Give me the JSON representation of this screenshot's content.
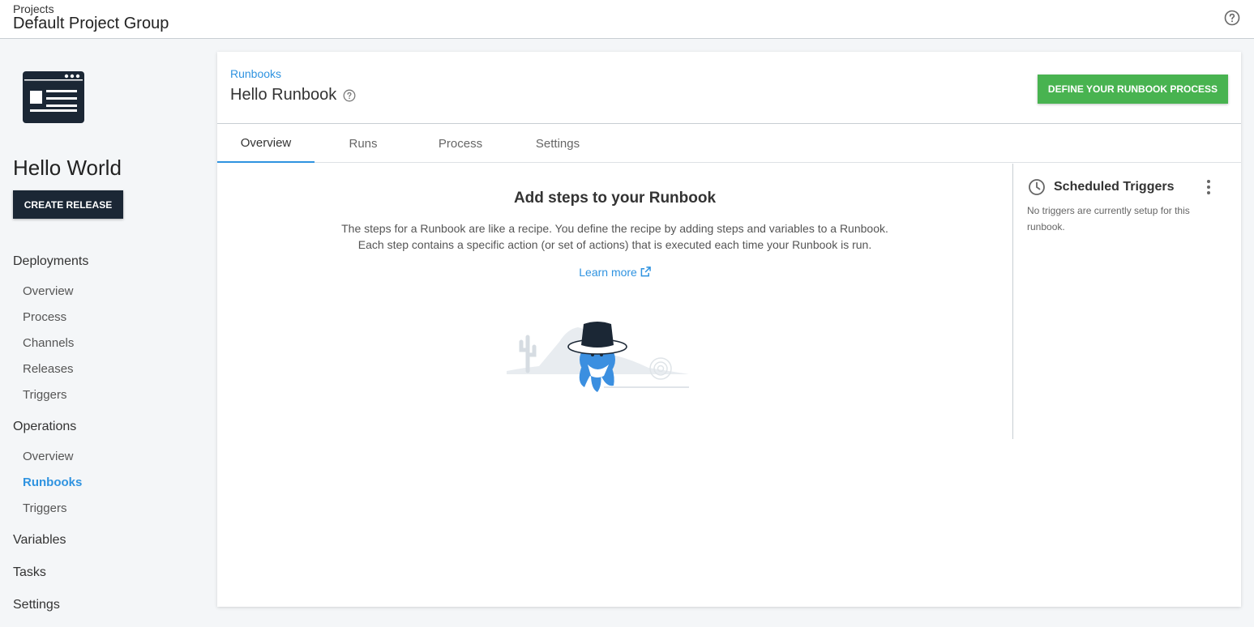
{
  "header": {
    "breadcrumb": "Projects",
    "group_name": "Default Project Group",
    "help_icon": "help-circle-icon"
  },
  "sidebar": {
    "project_name": "Hello World",
    "create_release_label": "CREATE RELEASE",
    "deployments": {
      "heading": "Deployments",
      "items": [
        "Overview",
        "Process",
        "Channels",
        "Releases",
        "Triggers"
      ]
    },
    "operations": {
      "heading": "Operations",
      "items": [
        "Overview",
        "Runbooks",
        "Triggers"
      ],
      "active": "Runbooks"
    },
    "variables": "Variables",
    "tasks": "Tasks",
    "settings": "Settings"
  },
  "main": {
    "breadcrumb": "Runbooks",
    "title": "Hello Runbook",
    "define_button_label": "DEFINE YOUR RUNBOOK PROCESS",
    "tabs": [
      "Overview",
      "Runs",
      "Process",
      "Settings"
    ],
    "active_tab": "Overview",
    "empty_state": {
      "title": "Add steps to your Runbook",
      "description_line1": "The steps for a Runbook are like a recipe. You define the recipe by adding steps and variables to a Runbook.",
      "description_line2": "Each step contains a specific action (or set of actions) that is executed each time your Runbook is run.",
      "learn_more": "Learn more"
    },
    "scheduled_triggers": {
      "title": "Scheduled Triggers",
      "empty_text": "No triggers are currently setup for this runbook."
    }
  },
  "colors": {
    "accent_blue": "#2f93e0",
    "primary_dark": "#1b2735",
    "success_green": "#48b350"
  }
}
